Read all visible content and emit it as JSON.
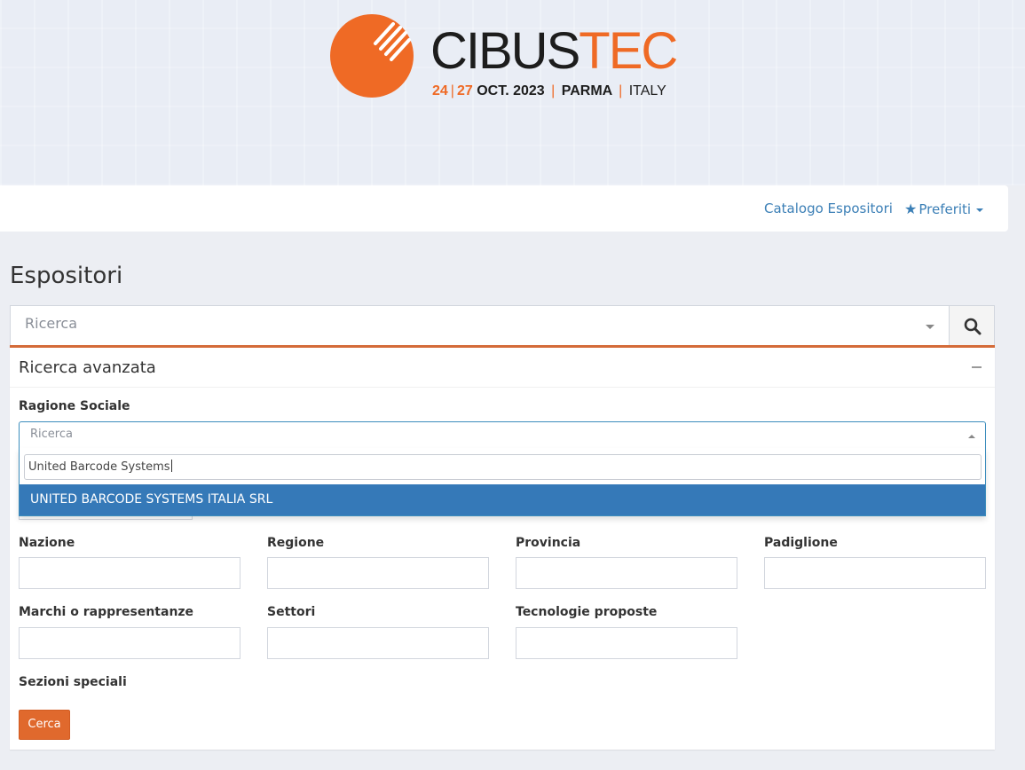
{
  "logo": {
    "word_dark": "CIBUS",
    "word_orange": "TEC",
    "date_orange": "24",
    "date_orange2": "27",
    "date_rest": "OCT. 2023",
    "city": "PARMA",
    "country": "ITALY"
  },
  "nav": {
    "catalogo": "Catalogo Espositori",
    "preferiti": "Preferiti"
  },
  "page": {
    "title": "Espositori"
  },
  "main_search": {
    "placeholder": "Ricerca"
  },
  "advanced": {
    "title": "Ricerca avanzata",
    "ragione_sociale": {
      "label": "Ragione Sociale",
      "placeholder": "Ricerca",
      "search_value": "United Barcode Systems",
      "options": [
        "UNITED BARCODE SYSTEMS ITALIA SRL"
      ]
    },
    "fields": {
      "nazione": "Nazione",
      "regione": "Regione",
      "provincia": "Provincia",
      "padiglione": "Padiglione",
      "marchi": "Marchi o rappresentanze",
      "settori": "Settori",
      "tecnologie": "Tecnologie proposte",
      "sezioni": "Sezioni speciali"
    },
    "submit_label": "Cerca"
  },
  "colors": {
    "brand_orange": "#ef6a25",
    "link_blue": "#3b7fb6",
    "selected_option": "#3579b8",
    "panel_accent": "#d46b39"
  },
  "icons": {
    "nav_star": "star-icon",
    "search": "search-icon",
    "collapse": "minus-icon"
  }
}
